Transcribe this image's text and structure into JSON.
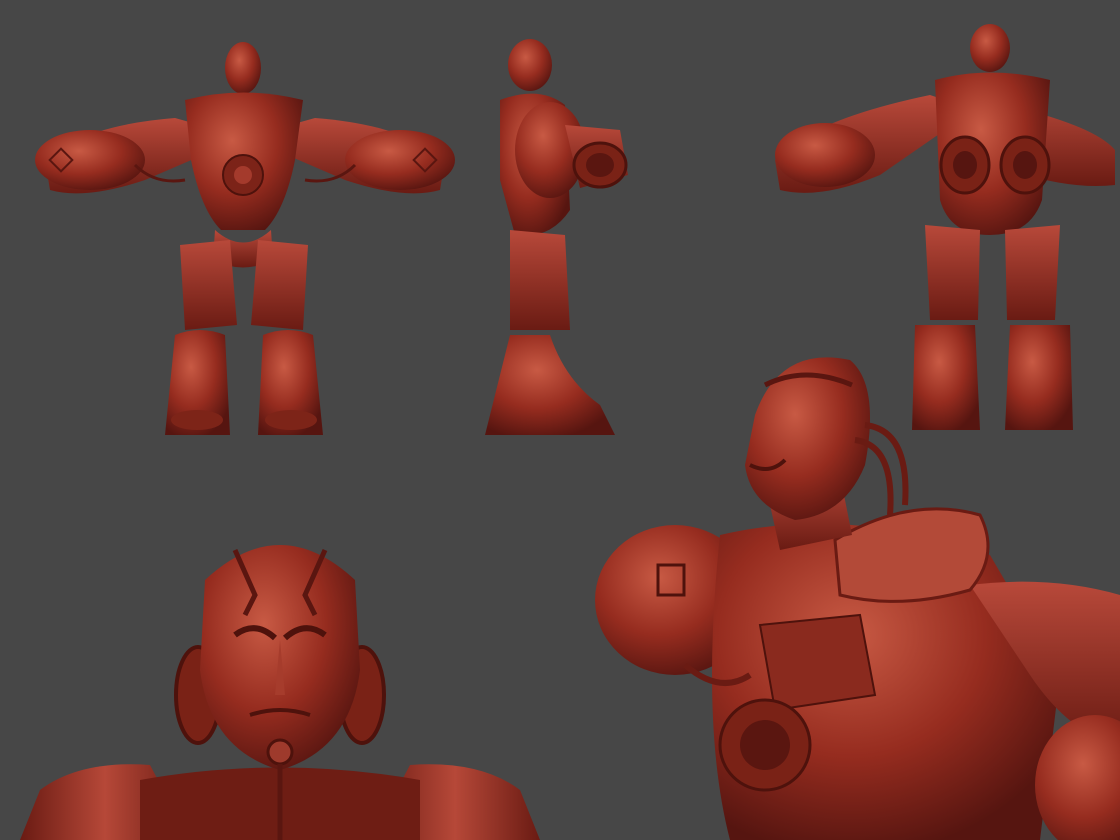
{
  "scene": {
    "background_color": "#474747",
    "clay_color": "#8f2a1e",
    "clay_highlight": "#c04a36",
    "clay_shadow": "#5a1610"
  },
  "views": [
    {
      "id": "front-view",
      "icon": "sculpt-front-render"
    },
    {
      "id": "side-view",
      "icon": "sculpt-side-render"
    },
    {
      "id": "back-view",
      "icon": "sculpt-back-render"
    },
    {
      "id": "head-closeup",
      "icon": "sculpt-head-render"
    },
    {
      "id": "perspective-closeup",
      "icon": "sculpt-perspective-render"
    }
  ]
}
